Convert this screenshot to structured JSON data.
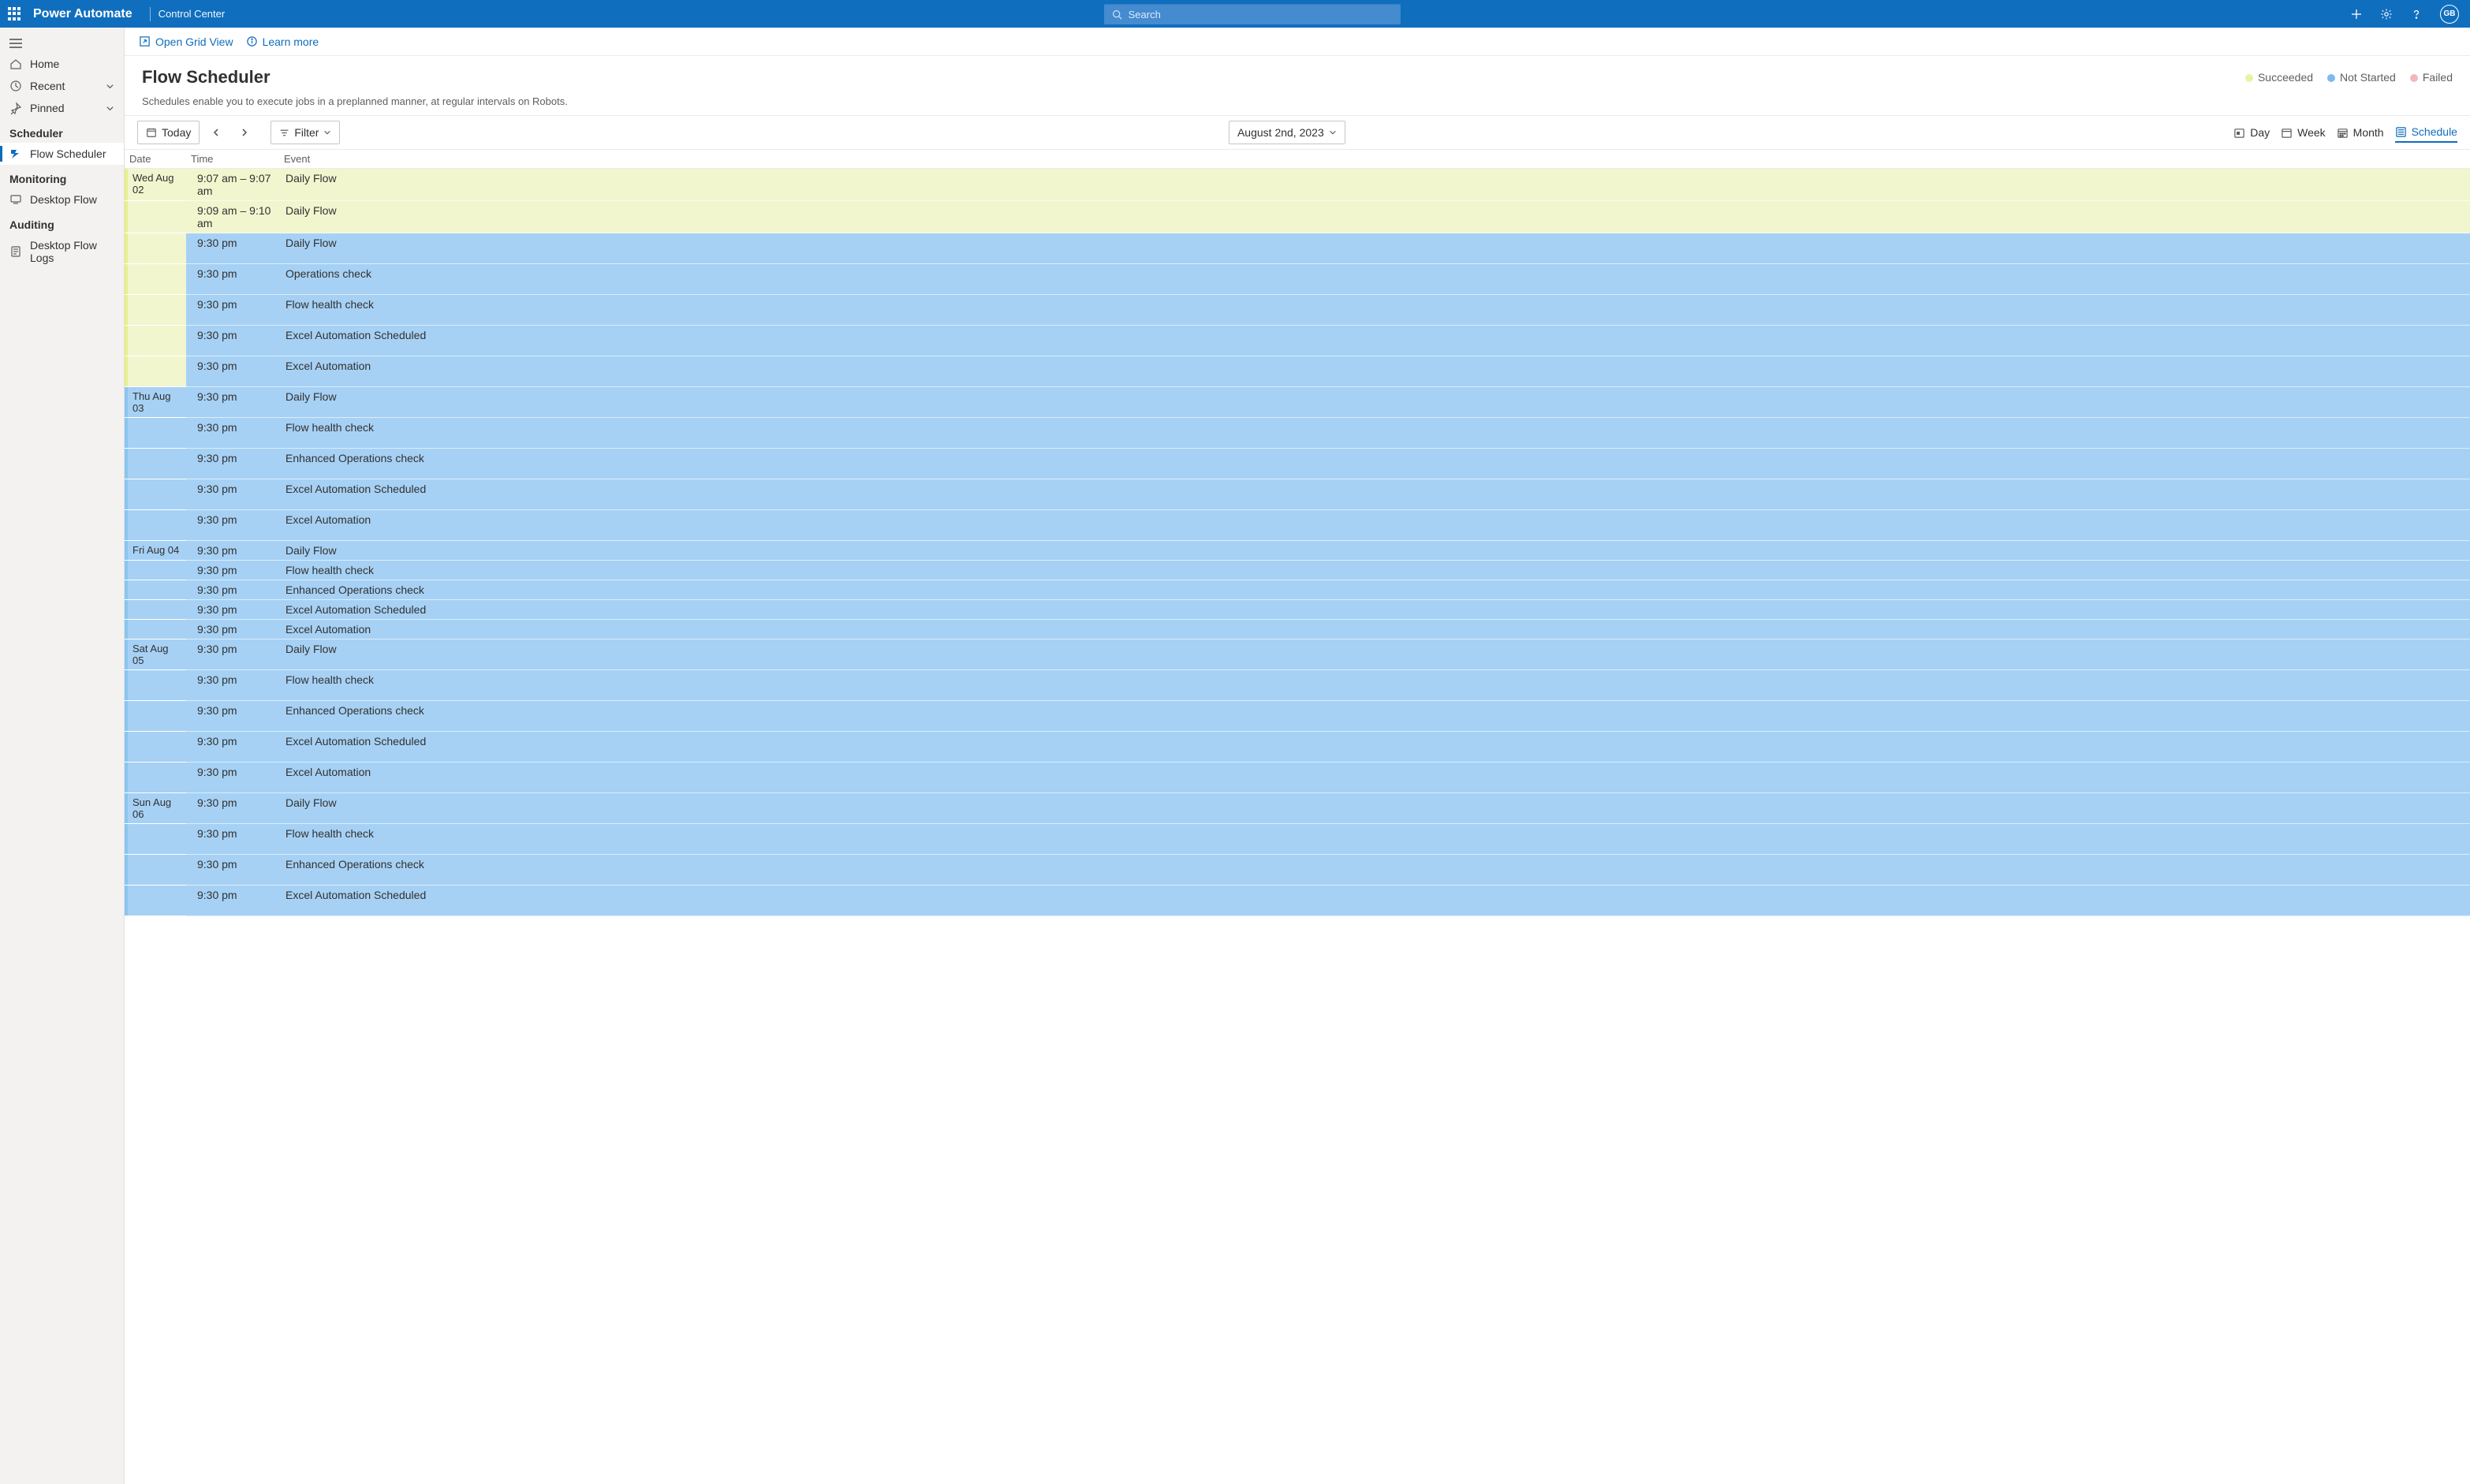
{
  "header": {
    "brand": "Power Automate",
    "subtitle": "Control Center",
    "search_placeholder": "Search",
    "avatar_initials": "GB"
  },
  "sidebar": {
    "home": "Home",
    "recent": "Recent",
    "pinned": "Pinned",
    "section_scheduler": "Scheduler",
    "flow_scheduler": "Flow Scheduler",
    "section_monitoring": "Monitoring",
    "desktop_flow": "Desktop Flow",
    "section_auditing": "Auditing",
    "desktop_flow_logs": "Desktop Flow Logs"
  },
  "cmdbar": {
    "open_grid": "Open Grid View",
    "learn_more": "Learn more"
  },
  "page": {
    "title": "Flow Scheduler",
    "subtitle": "Schedules enable you to execute jobs in a preplanned manner, at regular intervals on Robots."
  },
  "legend": {
    "succeeded": {
      "label": "Succeeded",
      "color": "#e9f2a4"
    },
    "not_started": {
      "label": "Not Started",
      "color": "#7bbaf0"
    },
    "failed": {
      "label": "Failed",
      "color": "#f5b7b7"
    }
  },
  "toolbar": {
    "today": "Today",
    "filter": "Filter",
    "date_label": "August 2nd, 2023",
    "views": {
      "day": "Day",
      "week": "Week",
      "month": "Month",
      "schedule": "Schedule"
    }
  },
  "table": {
    "headers": {
      "date": "Date",
      "time": "Time",
      "event": "Event"
    },
    "rows": [
      {
        "date": "Wed Aug 02",
        "time": "9:07 am – 9:07 am",
        "event": "Daily Flow",
        "status": "succeeded",
        "day_first": true,
        "strip": "succeeded"
      },
      {
        "date": "Wed Aug 02",
        "time": "9:09 am – 9:10 am",
        "event": "Daily Flow",
        "status": "succeeded",
        "strip": "succeeded"
      },
      {
        "date": "Wed Aug 02",
        "time": "9:30 pm",
        "event": "Daily Flow",
        "status": "notstarted",
        "strip": "succeeded"
      },
      {
        "date": "Wed Aug 02",
        "time": "9:30 pm",
        "event": "Operations check",
        "status": "notstarted",
        "strip": "succeeded"
      },
      {
        "date": "Wed Aug 02",
        "time": "9:30 pm",
        "event": "Flow health check",
        "status": "notstarted",
        "strip": "succeeded"
      },
      {
        "date": "Wed Aug 02",
        "time": "9:30 pm",
        "event": "Excel Automation Scheduled",
        "status": "notstarted",
        "strip": "succeeded"
      },
      {
        "date": "Wed Aug 02",
        "time": "9:30 pm",
        "event": "Excel Automation",
        "status": "notstarted",
        "strip": "succeeded"
      },
      {
        "date": "Thu Aug 03",
        "time": "9:30 pm",
        "event": "Daily Flow",
        "status": "notstarted",
        "day_first": true,
        "strip": "notstarted"
      },
      {
        "date": "Thu Aug 03",
        "time": "9:30 pm",
        "event": "Flow health check",
        "status": "notstarted",
        "strip": "notstarted"
      },
      {
        "date": "Thu Aug 03",
        "time": "9:30 pm",
        "event": "Enhanced Operations check",
        "status": "notstarted",
        "strip": "notstarted"
      },
      {
        "date": "Thu Aug 03",
        "time": "9:30 pm",
        "event": "Excel Automation Scheduled",
        "status": "notstarted",
        "strip": "notstarted"
      },
      {
        "date": "Thu Aug 03",
        "time": "9:30 pm",
        "event": "Excel Automation",
        "status": "notstarted",
        "strip": "notstarted"
      },
      {
        "date": "Fri Aug 04",
        "time": "9:30 pm",
        "event": "Daily Flow",
        "status": "notstarted",
        "day_first": true,
        "strip": "notstarted"
      },
      {
        "date": "Fri Aug 04",
        "time": "9:30 pm",
        "event": "Flow health check",
        "status": "notstarted",
        "strip": "notstarted"
      },
      {
        "date": "Fri Aug 04",
        "time": "9:30 pm",
        "event": "Enhanced Operations check",
        "status": "notstarted",
        "strip": "notstarted"
      },
      {
        "date": "Fri Aug 04",
        "time": "9:30 pm",
        "event": "Excel Automation Scheduled",
        "status": "notstarted",
        "strip": "notstarted"
      },
      {
        "date": "Fri Aug 04",
        "time": "9:30 pm",
        "event": "Excel Automation",
        "status": "notstarted",
        "strip": "notstarted"
      },
      {
        "date": "Sat Aug 05",
        "time": "9:30 pm",
        "event": "Daily Flow",
        "status": "notstarted",
        "day_first": true,
        "strip": "notstarted"
      },
      {
        "date": "Sat Aug 05",
        "time": "9:30 pm",
        "event": "Flow health check",
        "status": "notstarted",
        "strip": "notstarted"
      },
      {
        "date": "Sat Aug 05",
        "time": "9:30 pm",
        "event": "Enhanced Operations check",
        "status": "notstarted",
        "strip": "notstarted"
      },
      {
        "date": "Sat Aug 05",
        "time": "9:30 pm",
        "event": "Excel Automation Scheduled",
        "status": "notstarted",
        "strip": "notstarted"
      },
      {
        "date": "Sat Aug 05",
        "time": "9:30 pm",
        "event": "Excel Automation",
        "status": "notstarted",
        "strip": "notstarted"
      },
      {
        "date": "Sun Aug 06",
        "time": "9:30 pm",
        "event": "Daily Flow",
        "status": "notstarted",
        "day_first": true,
        "strip": "notstarted"
      },
      {
        "date": "Sun Aug 06",
        "time": "9:30 pm",
        "event": "Flow health check",
        "status": "notstarted",
        "strip": "notstarted"
      },
      {
        "date": "Sun Aug 06",
        "time": "9:30 pm",
        "event": "Enhanced Operations check",
        "status": "notstarted",
        "strip": "notstarted"
      },
      {
        "date": "Sun Aug 06",
        "time": "9:30 pm",
        "event": "Excel Automation Scheduled",
        "status": "notstarted",
        "strip": "notstarted"
      }
    ]
  }
}
